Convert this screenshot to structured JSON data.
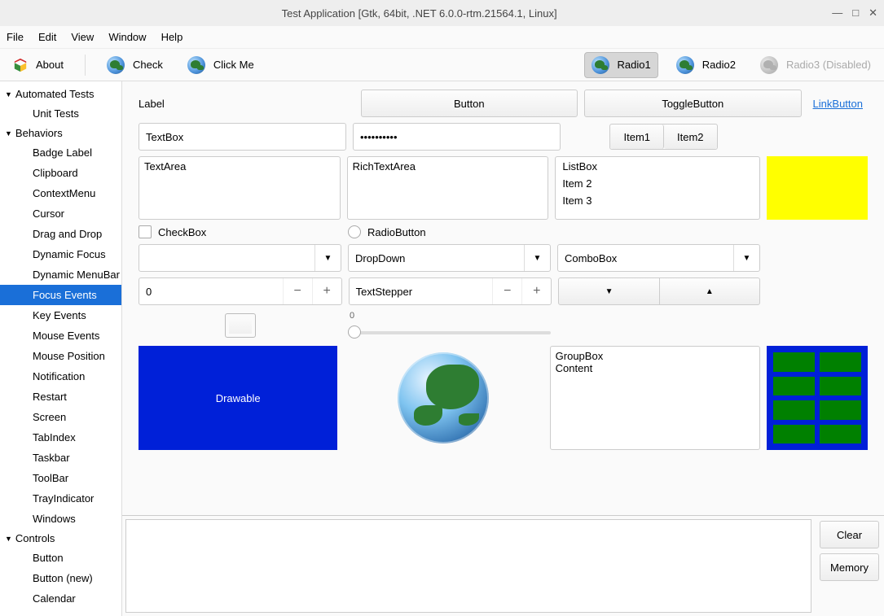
{
  "window": {
    "title": "Test Application [Gtk, 64bit, .NET 6.0.0-rtm.21564.1, Linux]"
  },
  "menubar": [
    "File",
    "Edit",
    "View",
    "Window",
    "Help"
  ],
  "toolbar": {
    "about": "About",
    "check": "Check",
    "clickme": "Click Me",
    "radio1": "Radio1",
    "radio2": "Radio2",
    "radio3": "Radio3 (Disabled)"
  },
  "tree": {
    "g1": {
      "h": "Automated Tests",
      "items": [
        "Unit Tests"
      ]
    },
    "g2": {
      "h": "Behaviors",
      "items": [
        "Badge Label",
        "Clipboard",
        "ContextMenu",
        "Cursor",
        "Drag and Drop",
        "Dynamic Focus",
        "Dynamic MenuBar",
        "Focus Events",
        "Key Events",
        "Mouse Events",
        "Mouse Position",
        "Notification",
        "Restart",
        "Screen",
        "TabIndex",
        "Taskbar",
        "ToolBar",
        "TrayIndicator",
        "Windows"
      ]
    },
    "g3": {
      "h": "Controls",
      "items": [
        "Button",
        "Button (new)",
        "Calendar"
      ]
    },
    "selected": "Focus Events"
  },
  "form": {
    "label": "Label",
    "button": "Button",
    "toggle": "ToggleButton",
    "link": "LinkButton",
    "textbox": "TextBox",
    "password": "••••••••••",
    "seg1": "Item1",
    "seg2": "Item2",
    "textarea": "TextArea",
    "richtext": "RichTextArea",
    "listbox": [
      "ListBox",
      "Item 2",
      "Item 3"
    ],
    "checkbox": "CheckBox",
    "radio": "RadioButton",
    "dropdown": "DropDown",
    "combobox": "ComboBox",
    "numstep": "0",
    "textstep": "TextStepper",
    "slider": "0",
    "drawable": "Drawable",
    "groupbox": {
      "title": "GroupBox",
      "content": "Content"
    },
    "clear": "Clear",
    "memory": "Memory"
  }
}
